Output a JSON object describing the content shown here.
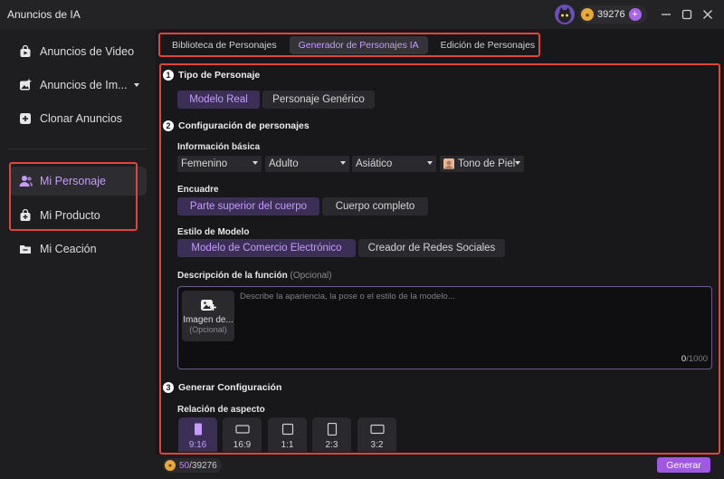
{
  "app": {
    "title": "Anuncios de IA",
    "credits": "39276"
  },
  "sidebar": {
    "items": [
      {
        "label": "Anuncios de Video"
      },
      {
        "label": "Anuncios de Im..."
      },
      {
        "label": "Clonar Anuncios"
      },
      {
        "label": "Mi Personaje"
      },
      {
        "label": "Mi Producto"
      },
      {
        "label": "Mi Ceación"
      }
    ]
  },
  "tabs": [
    "Biblioteca de Personajes",
    "Generador de Personajes IA",
    "Edición de Personajes"
  ],
  "section1": {
    "number": "1",
    "title": "Tipo de Personaje",
    "options": [
      "Modelo Real",
      "Personaje Genérico"
    ]
  },
  "section2": {
    "number": "2",
    "title": "Configuración de personajes",
    "basic_info": {
      "label": "Información básica",
      "gender": "Femenino",
      "age": "Adulto",
      "ethnicity": "Asiático",
      "skin": "Tono de Piel"
    },
    "framing": {
      "label": "Encuadre",
      "options": [
        "Parte superior del cuerpo",
        "Cuerpo completo"
      ]
    },
    "style": {
      "label": "Estilo de Modelo",
      "options": [
        "Modelo de Comercio Electrónico",
        "Creador de Redes Sociales"
      ]
    },
    "description": {
      "label": "Descripción de la función",
      "optional": "(Opcional)",
      "placeholder": "Describe la apariencia, la pose o el estilo de la modelo...",
      "upload_label": "Imagen de...",
      "upload_sub": "(Opcional)",
      "count": "0",
      "max": "/1000"
    }
  },
  "section3": {
    "number": "3",
    "title": "Generar Configuración",
    "aspect": {
      "label": "Relación de aspecto",
      "options": [
        "9:16",
        "16:9",
        "1:1",
        "2:3",
        "3:2"
      ]
    }
  },
  "footer": {
    "credits_used": "50",
    "credits_total": "/39276",
    "generate_label": "Generar"
  },
  "colors": {
    "accent": "#a058e3",
    "accent_text": "#c79bff",
    "highlight_box": "#e0453a"
  }
}
